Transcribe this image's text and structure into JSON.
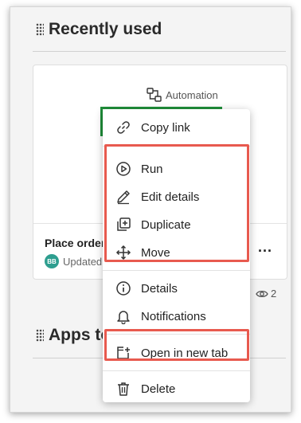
{
  "sections": {
    "recently_used": "Recently used",
    "apps_to": "Apps to"
  },
  "card": {
    "type_label": "Automation",
    "name": "Place order",
    "updated": "Updated",
    "avatar_initials": "BB",
    "more": "...",
    "views": "2"
  },
  "menu": {
    "copy_link": "Copy link",
    "run": "Run",
    "edit_details": "Edit details",
    "duplicate": "Duplicate",
    "move": "Move",
    "details": "Details",
    "notifications": "Notifications",
    "open_new_tab": "Open in new tab",
    "delete": "Delete"
  },
  "colors": {
    "highlight": "#e85a4f",
    "accent_green": "#1f8f3a",
    "avatar": "#2e9e8f"
  }
}
